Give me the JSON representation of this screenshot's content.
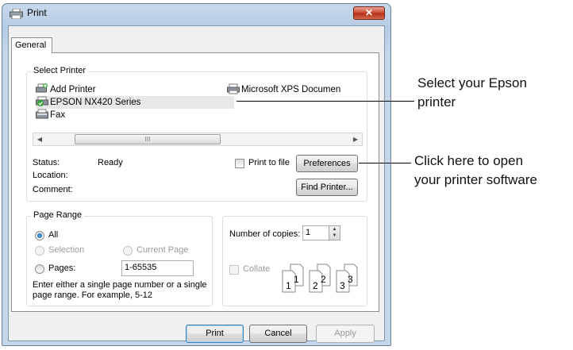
{
  "window": {
    "title": "Print",
    "close_label": "✕"
  },
  "tab": {
    "label": "General"
  },
  "select_printer": {
    "title": "Select Printer",
    "printers": [
      "Add Printer",
      "Microsoft XPS Documen",
      "EPSON NX420 Series",
      "Fax"
    ],
    "selected": "EPSON NX420 Series",
    "scroll_thumb": "III"
  },
  "status": {
    "status_label": "Status:",
    "status_value": "Ready",
    "location_label": "Location:",
    "location_value": "",
    "comment_label": "Comment:",
    "comment_value": "",
    "print_to_file_label": "Print to file",
    "preferences_label": "Preferences",
    "find_printer_label": "Find Printer..."
  },
  "page_range": {
    "title": "Page Range",
    "all_label": "All",
    "selection_label": "Selection",
    "current_page_label": "Current Page",
    "pages_label": "Pages:",
    "pages_value": "1-65535",
    "hint": [
      "Enter either a single page number or a single",
      "page range.  For example, 5-12"
    ],
    "selected": "All"
  },
  "copies": {
    "label": "Number of copies:",
    "value": "1",
    "collate_label": "Collate",
    "collate_checked": false,
    "page_numbers": [
      "1",
      "1",
      "2",
      "2",
      "3",
      "3"
    ]
  },
  "footer": {
    "print_label": "Print",
    "cancel_label": "Cancel",
    "apply_label": "Apply"
  },
  "annotations": {
    "select_printer": [
      "Select your Epson",
      "printer"
    ],
    "preferences": [
      "Click here to open",
      "your printer software"
    ]
  },
  "colors": {
    "selection_highlight": "#e8e8e8",
    "title_bar": "#c9d9ec",
    "close_button": "#c9452c"
  },
  "icons": {
    "title": "printer-icon",
    "add_printer": "add-printer-icon",
    "xps": "printer-icon",
    "epson": "default-printer-icon",
    "fax": "fax-icon"
  }
}
